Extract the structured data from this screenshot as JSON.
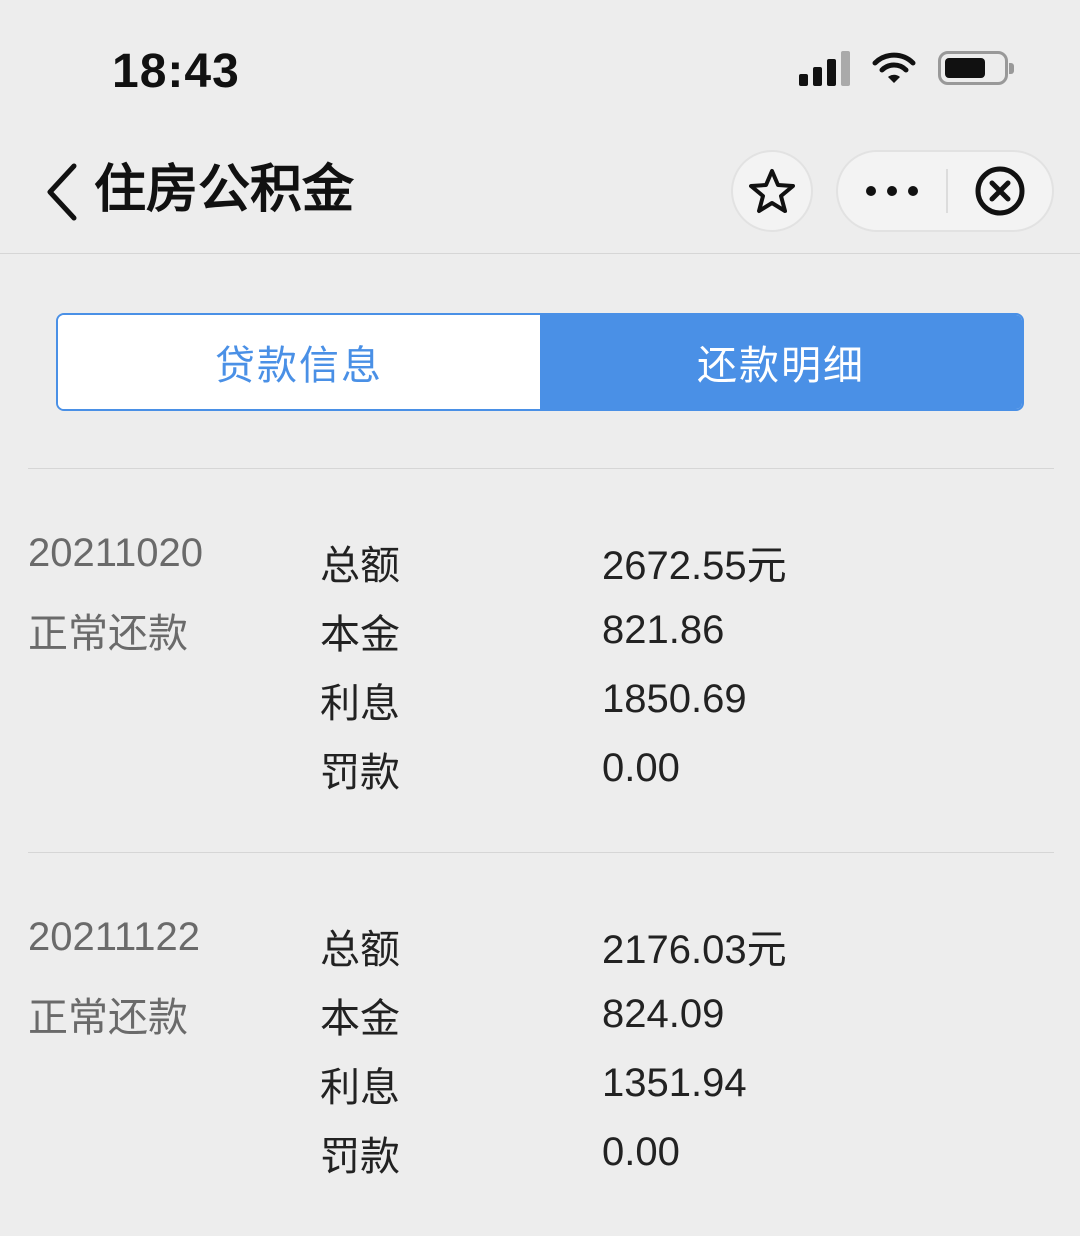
{
  "status_bar": {
    "time": "18:43"
  },
  "nav": {
    "title": "住房公积金"
  },
  "tabs": [
    {
      "label": "贷款信息",
      "active": false
    },
    {
      "label": "还款明细",
      "active": true
    }
  ],
  "colors": {
    "accent": "#4a90e6",
    "background": "#ededed"
  },
  "records": [
    {
      "date": "20211020",
      "type": "正常还款",
      "rows": [
        {
          "label": "总额",
          "value": "2672.55元"
        },
        {
          "label": "本金",
          "value": "821.86"
        },
        {
          "label": "利息",
          "value": "1850.69"
        },
        {
          "label": "罚款",
          "value": "0.00"
        }
      ]
    },
    {
      "date": "20211122",
      "type": "正常还款",
      "rows": [
        {
          "label": "总额",
          "value": "2176.03元"
        },
        {
          "label": "本金",
          "value": "824.09"
        },
        {
          "label": "利息",
          "value": "1351.94"
        },
        {
          "label": "罚款",
          "value": "0.00"
        }
      ]
    }
  ]
}
